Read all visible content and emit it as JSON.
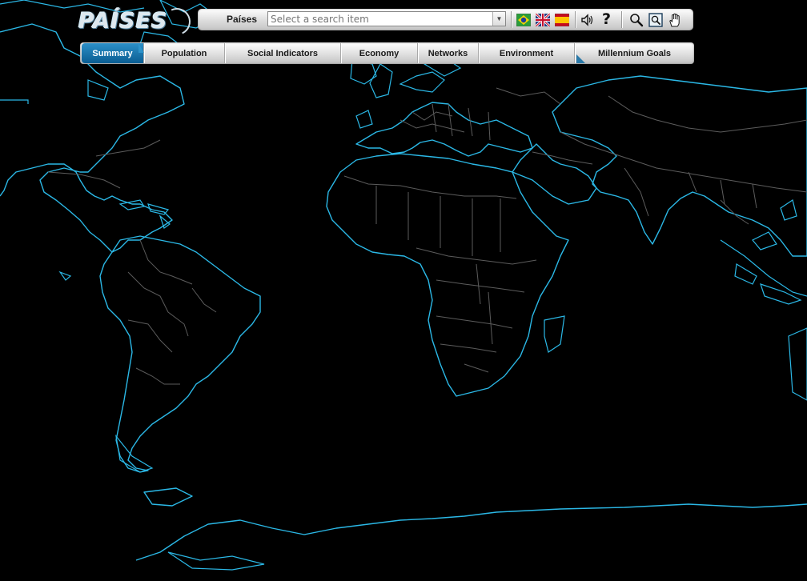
{
  "app": {
    "logo_text": "PAÍSES"
  },
  "toolbar": {
    "label": "Países",
    "search_placeholder": "Select a search item",
    "language_flags": [
      "brazil-flag-icon",
      "uk-flag-icon",
      "spain-flag-icon"
    ],
    "help_label": "?"
  },
  "nav": {
    "tabs": [
      {
        "label": "Summary",
        "active": true
      },
      {
        "label": "Population"
      },
      {
        "label": "Social Indicators"
      },
      {
        "label": "Economy"
      },
      {
        "label": "Networks"
      },
      {
        "label": "Environment"
      },
      {
        "label": "Millennium Goals"
      }
    ]
  },
  "colors": {
    "coastline": "#2bb8e6",
    "borders": "#5c5c5c",
    "ocean": "#000000",
    "active_tab": "#0a5d92"
  }
}
